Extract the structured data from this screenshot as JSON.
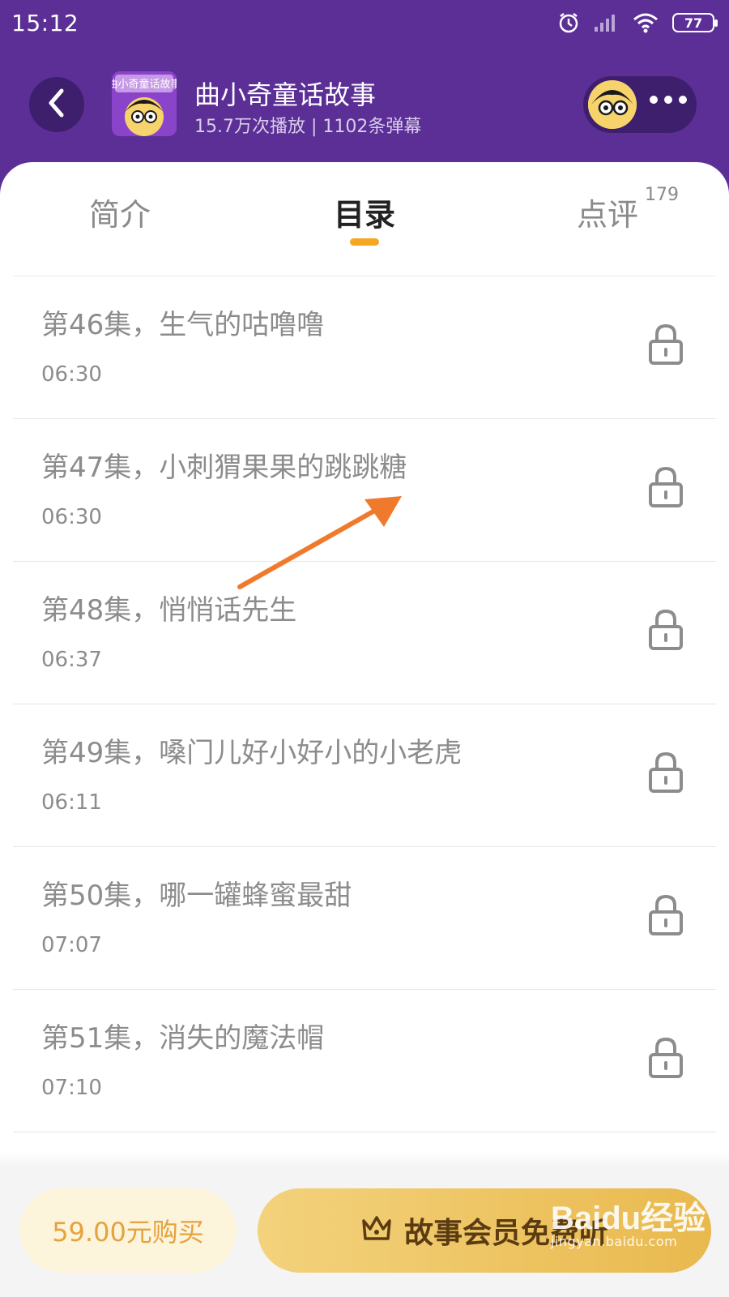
{
  "status_bar": {
    "time": "15:12",
    "battery": "77",
    "icons": [
      "alarm-icon",
      "signal-icon",
      "wifi-icon",
      "battery-icon"
    ]
  },
  "album": {
    "title": "曲小奇童话故事",
    "stats": "15.7万次播放 | 1102条弹幕",
    "cover_text": "曲小奇童话故事"
  },
  "tabs": [
    {
      "label": "简介",
      "active": false
    },
    {
      "label": "目录",
      "active": true
    },
    {
      "label": "点评",
      "active": false,
      "count": "179"
    }
  ],
  "episodes": [
    {
      "title": "第46集，生气的咕噜噜",
      "duration": "06:30",
      "locked": true
    },
    {
      "title": "第47集，小刺猬果果的跳跳糖",
      "duration": "06:30",
      "locked": true
    },
    {
      "title": "第48集，悄悄话先生",
      "duration": "06:37",
      "locked": true
    },
    {
      "title": "第49集，嗓门儿好小好小的小老虎",
      "duration": "06:11",
      "locked": true
    },
    {
      "title": "第50集，哪一罐蜂蜜最甜",
      "duration": "07:07",
      "locked": true
    },
    {
      "title": "第51集，消失的魔法帽",
      "duration": "07:10",
      "locked": true
    }
  ],
  "bottom_bar": {
    "buy_label": "59.00元购买",
    "vip_label": "故事会员免费听"
  },
  "watermark": {
    "main": "Baidu经验",
    "sub": "jingyan.baidu.com"
  },
  "colors": {
    "header_bg": "#5b2f96",
    "tab_indicator": "#f5a623",
    "arrow": "#f07a2c",
    "buy_text": "#e6a23c",
    "vip_bg": "#eec866"
  }
}
